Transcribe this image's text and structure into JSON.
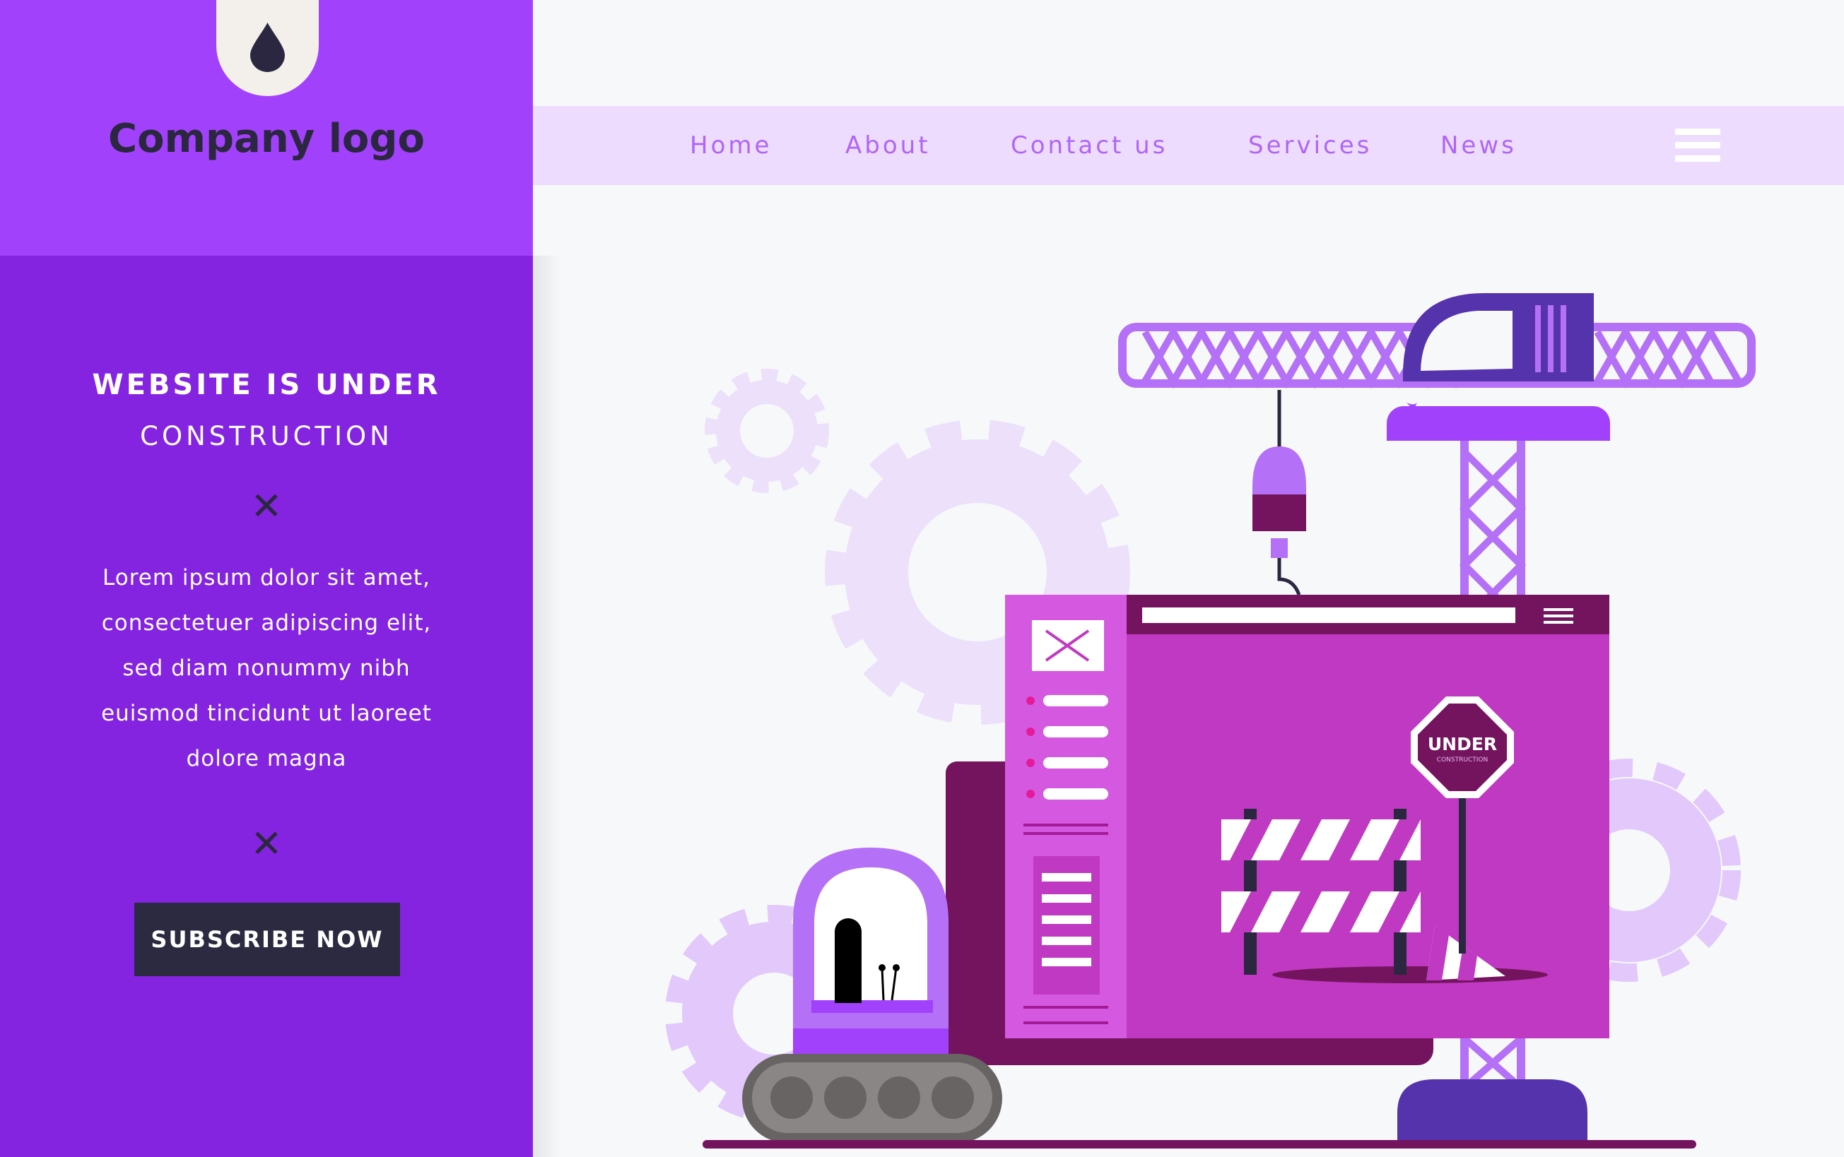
{
  "sidebar": {
    "logo_icon": "drop-icon",
    "company_logo": "Company logo",
    "headline_line1": "WEBSITE IS UNDER",
    "headline_line2": "CONSTRUCTION",
    "divider_icon": "x-icon",
    "body_lines": [
      "Lorem ipsum dolor sit amet,",
      "consectetuer adipiscing elit,",
      "sed diam nonummy nibh",
      "euismod tincidunt ut laoreet",
      "dolore magna"
    ],
    "subscribe_label": "SUBSCRIBE NOW"
  },
  "nav": {
    "items": [
      "Home",
      "About",
      "Contact us",
      "Services",
      "News"
    ],
    "menu_icon": "hamburger-icon"
  },
  "illustration": {
    "sign_line1": "UNDER",
    "sign_line2": "CONSTRUCTION"
  },
  "colors": {
    "sidebar_top": "#a241fb",
    "sidebar_bottom": "#8424e0",
    "nav_bg": "#eddcfd",
    "nav_text": "#b065f5",
    "button_bg": "#2b2a40"
  }
}
